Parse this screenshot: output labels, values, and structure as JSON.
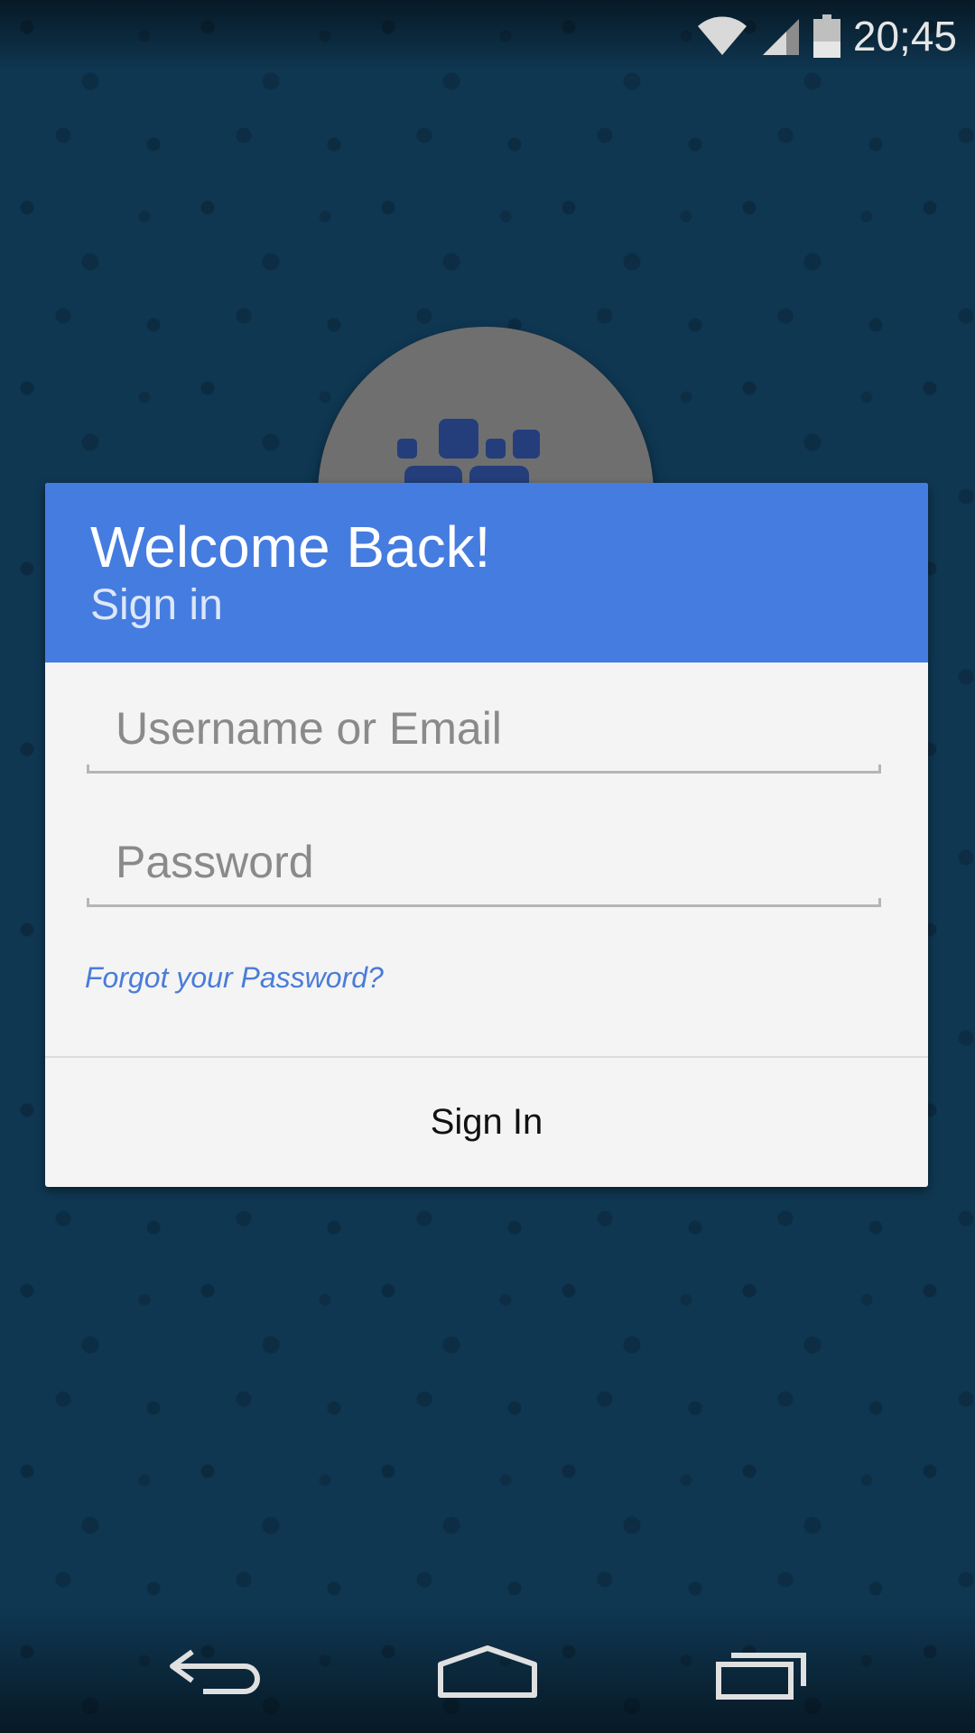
{
  "status_bar": {
    "time": "20;45",
    "icons": [
      "wifi-icon",
      "cellular-signal-icon",
      "battery-icon"
    ]
  },
  "logo": {
    "icon": "app-logo-icon",
    "circle_color": "#6f6f6f",
    "mark_color": "#233e7a"
  },
  "login_card": {
    "title": "Welcome Back!",
    "subtitle": "Sign in",
    "header_color": "#457ce0",
    "username_placeholder": "Username or Email",
    "username_value": "",
    "password_placeholder": "Password",
    "password_value": "",
    "forgot_link": "Forgot your Password?",
    "sign_in_button": "Sign In"
  },
  "nav_bar": {
    "buttons": [
      "back-icon",
      "home-icon",
      "recent-apps-icon"
    ]
  },
  "colors": {
    "background": "#0f3752",
    "link": "#4a7cd8"
  }
}
